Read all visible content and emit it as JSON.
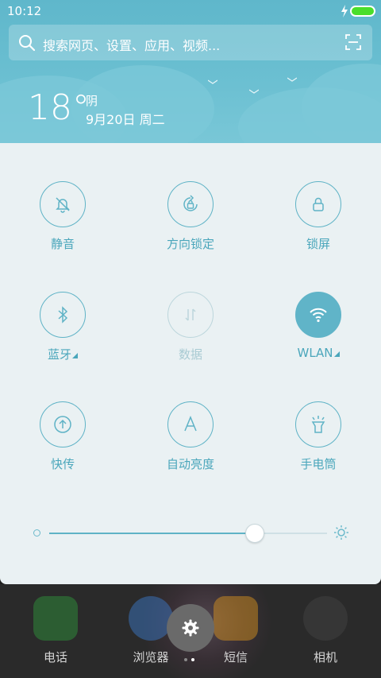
{
  "status_bar": {
    "time": "10:12"
  },
  "search": {
    "placeholder": "搜索网页、设置、应用、视频..."
  },
  "weather": {
    "temperature": "18°",
    "condition": "阴",
    "date": "9月20日 周二"
  },
  "toggles": [
    {
      "label": "静音",
      "icon": "bell-off-icon",
      "state": "off"
    },
    {
      "label": "方向锁定",
      "icon": "rotation-lock-icon",
      "state": "off"
    },
    {
      "label": "锁屏",
      "icon": "lock-icon",
      "state": "off"
    },
    {
      "label": "蓝牙",
      "icon": "bluetooth-icon",
      "state": "off",
      "has_more": true
    },
    {
      "label": "数据",
      "icon": "mobile-data-icon",
      "state": "disabled"
    },
    {
      "label": "WLAN",
      "icon": "wifi-icon",
      "state": "on",
      "has_more": true
    },
    {
      "label": "快传",
      "icon": "transfer-icon",
      "state": "off"
    },
    {
      "label": "自动亮度",
      "icon": "auto-brightness-icon",
      "state": "off"
    },
    {
      "label": "手电筒",
      "icon": "flashlight-icon",
      "state": "off"
    }
  ],
  "brightness": {
    "level": 0.74
  },
  "dock": [
    {
      "label": "电话",
      "icon": "phone-icon",
      "color": "#2e9b3c"
    },
    {
      "label": "浏览器",
      "icon": "browser-icon",
      "color": "#3b7fd3"
    },
    {
      "label": "短信",
      "icon": "message-icon",
      "color": "#e39a1d"
    },
    {
      "label": "相机",
      "icon": "camera-icon",
      "color": "#444444"
    }
  ],
  "colors": {
    "accent": "#5fb3c6",
    "panel": "#eaf1f3",
    "battery": "#4ade2a"
  },
  "page_indicator": {
    "pages": 2,
    "current": 2
  }
}
